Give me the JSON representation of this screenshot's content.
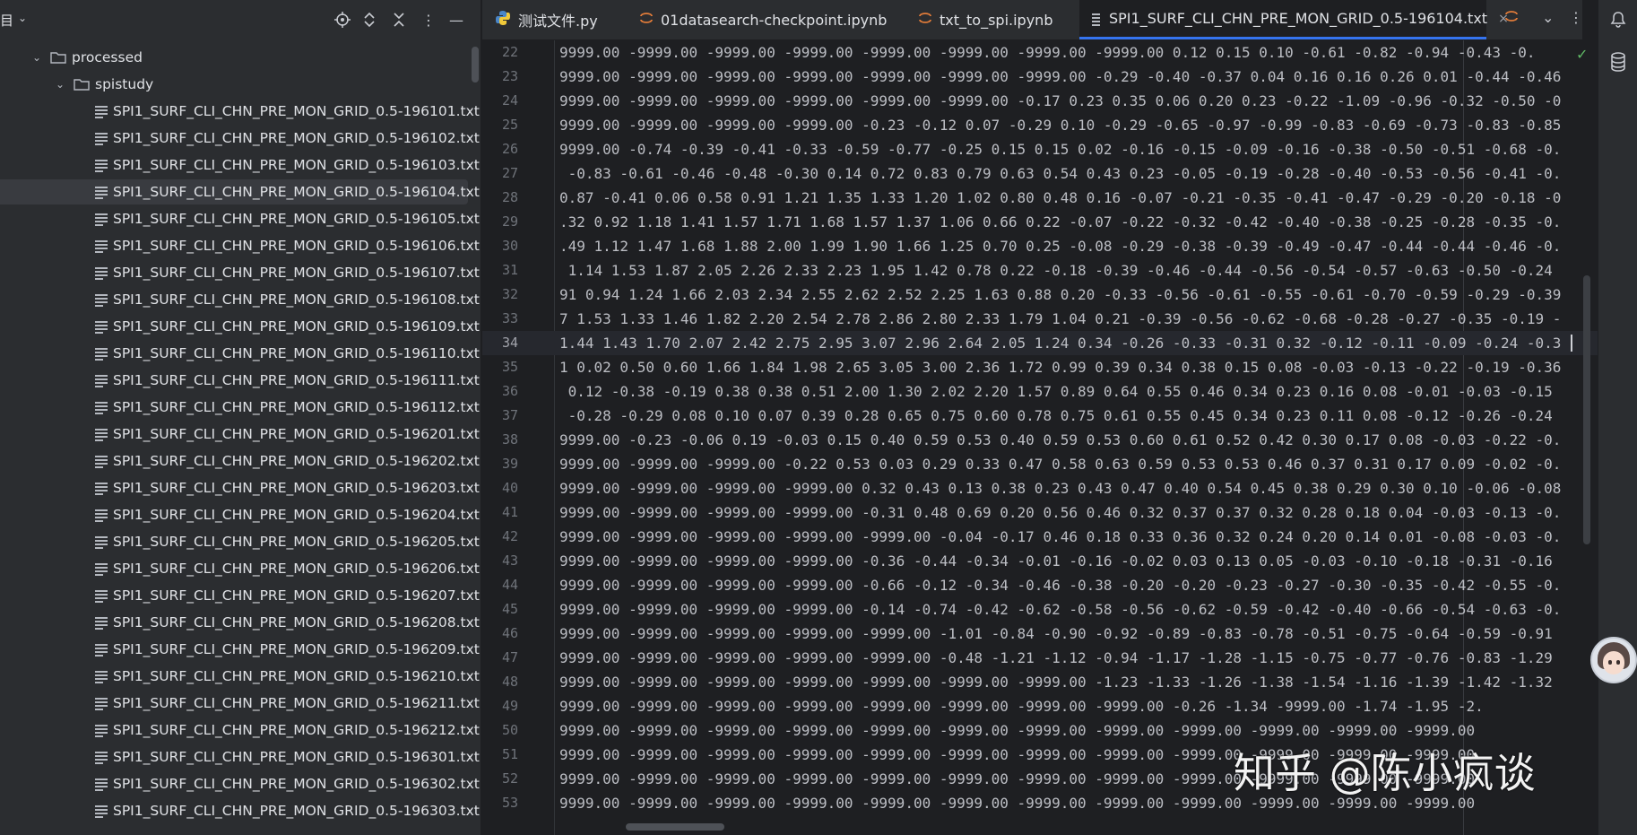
{
  "sidebar": {
    "title": "目",
    "tree": [
      {
        "label": "processed",
        "type": "folder",
        "depth": 1,
        "expanded": true
      },
      {
        "label": "spistudy",
        "type": "folder",
        "depth": 2,
        "expanded": true
      },
      {
        "label": "SPI1_SURF_CLI_CHN_PRE_MON_GRID_0.5-196101.txt",
        "type": "file",
        "depth": 3
      },
      {
        "label": "SPI1_SURF_CLI_CHN_PRE_MON_GRID_0.5-196102.txt",
        "type": "file",
        "depth": 3
      },
      {
        "label": "SPI1_SURF_CLI_CHN_PRE_MON_GRID_0.5-196103.txt",
        "type": "file",
        "depth": 3
      },
      {
        "label": "SPI1_SURF_CLI_CHN_PRE_MON_GRID_0.5-196104.txt",
        "type": "file",
        "depth": 3,
        "selected": true
      },
      {
        "label": "SPI1_SURF_CLI_CHN_PRE_MON_GRID_0.5-196105.txt",
        "type": "file",
        "depth": 3
      },
      {
        "label": "SPI1_SURF_CLI_CHN_PRE_MON_GRID_0.5-196106.txt",
        "type": "file",
        "depth": 3
      },
      {
        "label": "SPI1_SURF_CLI_CHN_PRE_MON_GRID_0.5-196107.txt",
        "type": "file",
        "depth": 3
      },
      {
        "label": "SPI1_SURF_CLI_CHN_PRE_MON_GRID_0.5-196108.txt",
        "type": "file",
        "depth": 3
      },
      {
        "label": "SPI1_SURF_CLI_CHN_PRE_MON_GRID_0.5-196109.txt",
        "type": "file",
        "depth": 3
      },
      {
        "label": "SPI1_SURF_CLI_CHN_PRE_MON_GRID_0.5-196110.txt",
        "type": "file",
        "depth": 3
      },
      {
        "label": "SPI1_SURF_CLI_CHN_PRE_MON_GRID_0.5-196111.txt",
        "type": "file",
        "depth": 3
      },
      {
        "label": "SPI1_SURF_CLI_CHN_PRE_MON_GRID_0.5-196112.txt",
        "type": "file",
        "depth": 3
      },
      {
        "label": "SPI1_SURF_CLI_CHN_PRE_MON_GRID_0.5-196201.txt",
        "type": "file",
        "depth": 3
      },
      {
        "label": "SPI1_SURF_CLI_CHN_PRE_MON_GRID_0.5-196202.txt",
        "type": "file",
        "depth": 3
      },
      {
        "label": "SPI1_SURF_CLI_CHN_PRE_MON_GRID_0.5-196203.txt",
        "type": "file",
        "depth": 3
      },
      {
        "label": "SPI1_SURF_CLI_CHN_PRE_MON_GRID_0.5-196204.txt",
        "type": "file",
        "depth": 3
      },
      {
        "label": "SPI1_SURF_CLI_CHN_PRE_MON_GRID_0.5-196205.txt",
        "type": "file",
        "depth": 3
      },
      {
        "label": "SPI1_SURF_CLI_CHN_PRE_MON_GRID_0.5-196206.txt",
        "type": "file",
        "depth": 3
      },
      {
        "label": "SPI1_SURF_CLI_CHN_PRE_MON_GRID_0.5-196207.txt",
        "type": "file",
        "depth": 3
      },
      {
        "label": "SPI1_SURF_CLI_CHN_PRE_MON_GRID_0.5-196208.txt",
        "type": "file",
        "depth": 3
      },
      {
        "label": "SPI1_SURF_CLI_CHN_PRE_MON_GRID_0.5-196209.txt",
        "type": "file",
        "depth": 3
      },
      {
        "label": "SPI1_SURF_CLI_CHN_PRE_MON_GRID_0.5-196210.txt",
        "type": "file",
        "depth": 3
      },
      {
        "label": "SPI1_SURF_CLI_CHN_PRE_MON_GRID_0.5-196211.txt",
        "type": "file",
        "depth": 3
      },
      {
        "label": "SPI1_SURF_CLI_CHN_PRE_MON_GRID_0.5-196212.txt",
        "type": "file",
        "depth": 3
      },
      {
        "label": "SPI1_SURF_CLI_CHN_PRE_MON_GRID_0.5-196301.txt",
        "type": "file",
        "depth": 3
      },
      {
        "label": "SPI1_SURF_CLI_CHN_PRE_MON_GRID_0.5-196302.txt",
        "type": "file",
        "depth": 3
      },
      {
        "label": "SPI1_SURF_CLI_CHN_PRE_MON_GRID_0.5-196303.txt",
        "type": "file",
        "depth": 3
      }
    ]
  },
  "tabs": [
    {
      "label": "测试文件.py",
      "icon": "python-icon",
      "active": false
    },
    {
      "label": "01datasearch-checkpoint.ipynb",
      "icon": "jupyter-icon",
      "active": false
    },
    {
      "label": "txt_to_spi.ipynb",
      "icon": "jupyter-icon",
      "active": false
    },
    {
      "label": "SPI1_SURF_CLI_CHN_PRE_MON_GRID_0.5-196104.txt",
      "icon": "text-file-icon",
      "active": true,
      "close": "×"
    }
  ],
  "editor": {
    "current_line": "34",
    "lines": [
      {
        "num": "22",
        "text": "9999.00 -9999.00 -9999.00 -9999.00 -9999.00 -9999.00 -9999.00 -9999.00 0.12 0.15 0.10 -0.61 -0.82 -0.94 -0.43 -0."
      },
      {
        "num": "23",
        "text": "9999.00 -9999.00 -9999.00 -9999.00 -9999.00 -9999.00 -9999.00 -0.29 -0.40 -0.37 0.04 0.16 0.16 0.26 0.01 -0.44 -0.46"
      },
      {
        "num": "24",
        "text": "9999.00 -9999.00 -9999.00 -9999.00 -9999.00 -9999.00 -0.17 0.23 0.35 0.06 0.20 0.23 -0.22 -1.09 -0.96 -0.32 -0.50 -0"
      },
      {
        "num": "25",
        "text": "9999.00 -9999.00 -9999.00 -9999.00 -0.23 -0.12 0.07 -0.29 0.10 -0.29 -0.65 -0.97 -0.99 -0.83 -0.69 -0.73 -0.83 -0.85"
      },
      {
        "num": "26",
        "text": "9999.00 -0.74 -0.39 -0.41 -0.33 -0.59 -0.77 -0.25 0.15 0.15 0.02 -0.16 -0.15 -0.09 -0.16 -0.38 -0.50 -0.51 -0.68 -0."
      },
      {
        "num": "27",
        "text": " -0.83 -0.61 -0.46 -0.48 -0.30 0.14 0.72 0.83 0.79 0.63 0.54 0.43 0.23 -0.05 -0.19 -0.28 -0.40 -0.53 -0.56 -0.41 -0."
      },
      {
        "num": "28",
        "text": "0.87 -0.41 0.06 0.58 0.91 1.21 1.35 1.33 1.20 1.02 0.80 0.48 0.16 -0.07 -0.21 -0.35 -0.41 -0.47 -0.29 -0.20 -0.18 -0"
      },
      {
        "num": "29",
        "text": ".32 0.92 1.18 1.41 1.57 1.71 1.68 1.57 1.37 1.06 0.66 0.22 -0.07 -0.22 -0.32 -0.42 -0.40 -0.38 -0.25 -0.28 -0.35 -0."
      },
      {
        "num": "30",
        "text": ".49 1.12 1.47 1.68 1.88 2.00 1.99 1.90 1.66 1.25 0.70 0.25 -0.08 -0.29 -0.38 -0.39 -0.49 -0.47 -0.44 -0.44 -0.46 -0."
      },
      {
        "num": "31",
        "text": " 1.14 1.53 1.87 2.05 2.26 2.33 2.23 1.95 1.42 0.78 0.22 -0.18 -0.39 -0.46 -0.44 -0.56 -0.54 -0.57 -0.63 -0.50 -0.24"
      },
      {
        "num": "32",
        "text": "91 0.94 1.24 1.66 2.03 2.34 2.55 2.62 2.52 2.25 1.63 0.88 0.20 -0.33 -0.56 -0.61 -0.55 -0.61 -0.70 -0.59 -0.29 -0.39"
      },
      {
        "num": "33",
        "text": "7 1.53 1.33 1.46 1.82 2.20 2.54 2.78 2.86 2.80 2.33 1.79 1.04 0.21 -0.39 -0.56 -0.62 -0.68 -0.28 -0.27 -0.35 -0.19 -"
      },
      {
        "num": "34",
        "text": "1.44 1.43 1.70 2.07 2.42 2.75 2.95 3.07 2.96 2.64 2.05 1.24 0.34 -0.26 -0.33 -0.31 0.32 -0.12 -0.11 -0.09 -0.24 -0.3"
      },
      {
        "num": "35",
        "text": "1 0.02 0.50 0.60 1.66 1.84 1.98 2.65 3.05 3.00 2.36 1.72 0.99 0.39 0.34 0.38 0.15 0.08 -0.03 -0.13 -0.22 -0.19 -0.36"
      },
      {
        "num": "36",
        "text": " 0.12 -0.38 -0.19 0.38 0.38 0.51 2.00 1.30 2.02 2.20 1.57 0.89 0.64 0.55 0.46 0.34 0.23 0.16 0.08 -0.01 -0.03 -0.15"
      },
      {
        "num": "37",
        "text": " -0.28 -0.29 0.08 0.10 0.07 0.39 0.28 0.65 0.75 0.60 0.78 0.75 0.61 0.55 0.45 0.34 0.23 0.11 0.08 -0.12 -0.26 -0.24"
      },
      {
        "num": "38",
        "text": "9999.00 -0.23 -0.06 0.19 -0.03 0.15 0.40 0.59 0.53 0.40 0.59 0.53 0.60 0.61 0.52 0.42 0.30 0.17 0.08 -0.03 -0.22 -0."
      },
      {
        "num": "39",
        "text": "9999.00 -9999.00 -9999.00 -0.22 0.53 0.03 0.29 0.33 0.47 0.58 0.63 0.59 0.53 0.53 0.46 0.37 0.31 0.17 0.09 -0.02 -0."
      },
      {
        "num": "40",
        "text": "9999.00 -9999.00 -9999.00 -9999.00 0.32 0.43 0.13 0.38 0.23 0.43 0.47 0.40 0.54 0.45 0.38 0.29 0.30 0.10 -0.06 -0.08"
      },
      {
        "num": "41",
        "text": "9999.00 -9999.00 -9999.00 -9999.00 -0.31 0.48 0.69 0.20 0.56 0.46 0.32 0.37 0.37 0.32 0.28 0.18 0.04 -0.03 -0.13 -0."
      },
      {
        "num": "42",
        "text": "9999.00 -9999.00 -9999.00 -9999.00 -9999.00 -0.04 -0.17 0.46 0.18 0.33 0.36 0.32 0.24 0.20 0.14 0.01 -0.08 -0.03 -0."
      },
      {
        "num": "43",
        "text": "9999.00 -9999.00 -9999.00 -9999.00 -0.36 -0.44 -0.34 -0.01 -0.16 -0.02 0.03 0.13 0.05 -0.03 -0.10 -0.18 -0.31 -0.16"
      },
      {
        "num": "44",
        "text": "9999.00 -9999.00 -9999.00 -9999.00 -0.66 -0.12 -0.34 -0.46 -0.38 -0.20 -0.20 -0.23 -0.27 -0.30 -0.35 -0.42 -0.55 -0."
      },
      {
        "num": "45",
        "text": "9999.00 -9999.00 -9999.00 -9999.00 -0.14 -0.74 -0.42 -0.62 -0.58 -0.56 -0.62 -0.59 -0.42 -0.40 -0.66 -0.54 -0.63 -0."
      },
      {
        "num": "46",
        "text": "9999.00 -9999.00 -9999.00 -9999.00 -9999.00 -1.01 -0.84 -0.90 -0.92 -0.89 -0.83 -0.78 -0.51 -0.75 -0.64 -0.59 -0.91"
      },
      {
        "num": "47",
        "text": "9999.00 -9999.00 -9999.00 -9999.00 -9999.00 -0.48 -1.21 -1.12 -0.94 -1.17 -1.28 -1.15 -0.75 -0.77 -0.76 -0.83 -1.29"
      },
      {
        "num": "48",
        "text": "9999.00 -9999.00 -9999.00 -9999.00 -9999.00 -9999.00 -9999.00 -1.23 -1.33 -1.26 -1.38 -1.54 -1.16 -1.39 -1.42 -1.32"
      },
      {
        "num": "49",
        "text": "9999.00 -9999.00 -9999.00 -9999.00 -9999.00 -9999.00 -9999.00 -9999.00 -0.26 -1.34 -9999.00 -1.74 -1.95 -2."
      },
      {
        "num": "50",
        "text": "9999.00 -9999.00 -9999.00 -9999.00 -9999.00 -9999.00 -9999.00 -9999.00 -9999.00 -9999.00 -9999.00 -9999.00"
      },
      {
        "num": "51",
        "text": "9999.00 -9999.00 -9999.00 -9999.00 -9999.00 -9999.00 -9999.00 -9999.00 -9999.00 -9999.00 -9999.00 -9999.00"
      },
      {
        "num": "52",
        "text": "9999.00 -9999.00 -9999.00 -9999.00 -9999.00 -9999.00 -9999.00 -9999.00 -9999.00 -9999.00 -9999.00 -9999.00"
      },
      {
        "num": "53",
        "text": "9999.00 -9999.00 -9999.00 -9999.00 -9999.00 -9999.00 -9999.00 -9999.00 -9999.00 -9999.00 -9999.00 -9999.00"
      }
    ]
  },
  "watermark": "知乎 @陈小疯谈",
  "colors": {
    "accent": "#3574f0",
    "check": "#5fb865",
    "background": "#1e1f22",
    "panel": "#2b2d30"
  }
}
